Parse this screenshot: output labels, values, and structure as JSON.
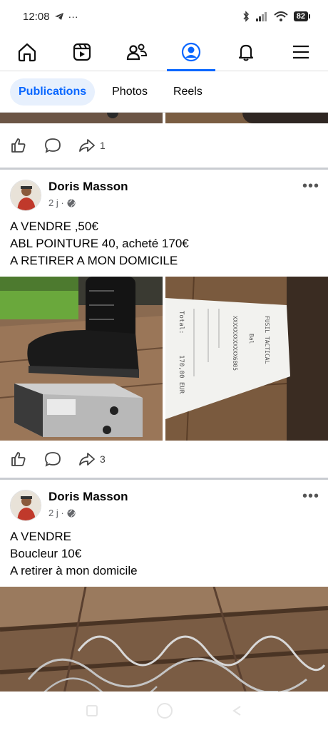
{
  "status_bar": {
    "time": "12:08",
    "notification_icons": "◄ ···",
    "battery": "82"
  },
  "nav": {
    "items": [
      {
        "name": "home-icon"
      },
      {
        "name": "video-icon"
      },
      {
        "name": "friends-icon"
      },
      {
        "name": "profile-icon",
        "active": true
      },
      {
        "name": "bell-icon"
      },
      {
        "name": "menu-icon"
      }
    ]
  },
  "filter_tabs": [
    {
      "label": "Publications",
      "active": true
    },
    {
      "label": "Photos"
    },
    {
      "label": "Reels"
    }
  ],
  "previous_post": {
    "share_count": "1"
  },
  "posts": [
    {
      "author": "Doris Masson",
      "time": "2 j ·",
      "text_lines": [
        "A VENDRE ,50€",
        "ABL POINTURE 40, acheté 170€",
        "A RETIRER A MON DOMICILE"
      ],
      "share_count": "3",
      "receipt_lines": [
        "Total:",
        "170,00 EUR",
        "XXXXXXXXXXXX6805",
        "FUSIL TACTICAL",
        "Bal"
      ]
    },
    {
      "author": "Doris Masson",
      "time": "2 j ·",
      "text_lines": [
        "A VENDRE",
        "Boucleur 10€",
        "A retirer à mon domicile"
      ]
    }
  ],
  "colors": {
    "accent": "#0866ff",
    "active_tab_bg": "#e7f0fd",
    "divider": "#c9ccd1",
    "meta": "#65676b"
  }
}
